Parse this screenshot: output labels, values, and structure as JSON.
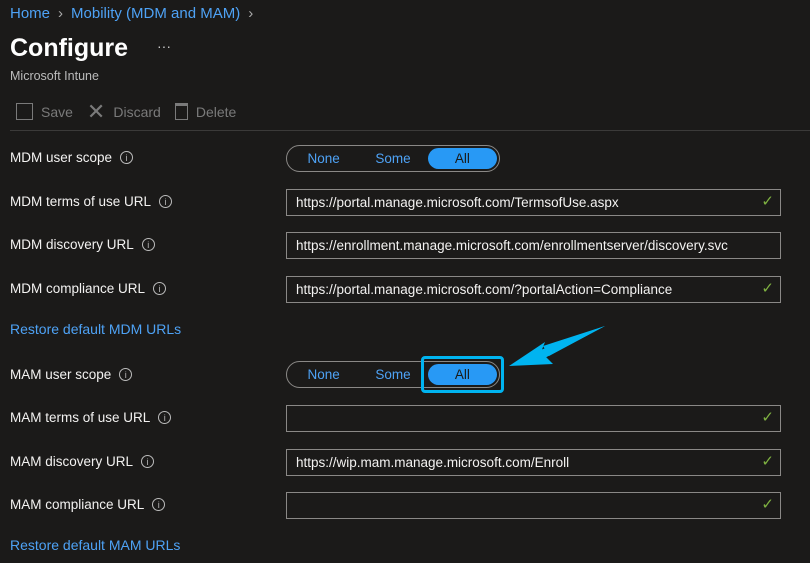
{
  "breadcrumb": [
    "Home",
    "Mobility (MDM and MAM)"
  ],
  "title": "Configure",
  "more": "···",
  "subtitle": "Microsoft Intune",
  "toolbar": {
    "save": "Save",
    "discard": "Discard",
    "delete": "Delete"
  },
  "scope_options": [
    "None",
    "Some",
    "All"
  ],
  "mdm": {
    "scope_label": "MDM user scope",
    "scope_selected": "All",
    "fields": [
      {
        "label": "MDM terms of use URL",
        "value": "https://portal.manage.microsoft.com/TermsofUse.aspx"
      },
      {
        "label": "MDM discovery URL",
        "value": "https://enrollment.manage.microsoft.com/enrollmentserver/discovery.svc"
      },
      {
        "label": "MDM compliance URL",
        "value": "https://portal.manage.microsoft.com/?portalAction=Compliance"
      }
    ],
    "restore": "Restore default MDM URLs"
  },
  "mam": {
    "scope_label": "MAM user scope",
    "scope_selected": "All",
    "fields": [
      {
        "label": "MAM terms of use URL",
        "value": ""
      },
      {
        "label": "MAM discovery URL",
        "value": "https://wip.mam.manage.microsoft.com/Enroll"
      },
      {
        "label": "MAM compliance URL",
        "value": ""
      }
    ],
    "restore": "Restore default MAM URLs"
  },
  "colors": {
    "accent": "#2899f5",
    "highlight": "#00b4f0",
    "check": "#7fb241"
  }
}
